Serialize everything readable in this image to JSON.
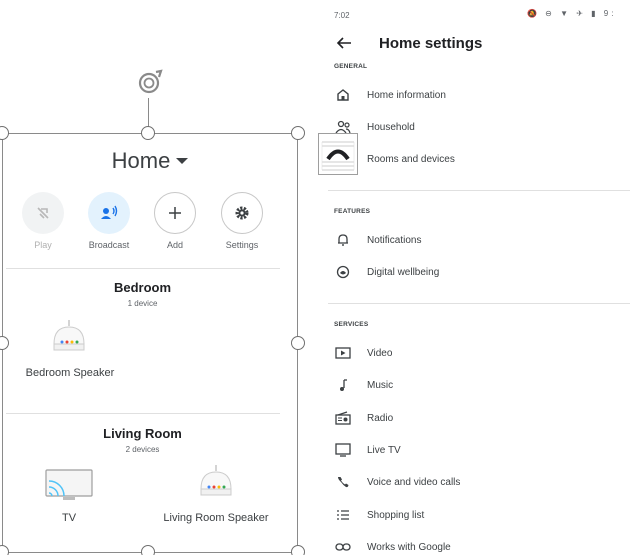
{
  "left_panel": {
    "home_title": "Home",
    "actions": [
      {
        "label": "Play",
        "icon": "play-disabled-icon"
      },
      {
        "label": "Broadcast",
        "icon": "broadcast-icon"
      },
      {
        "label": "Add",
        "icon": "add-icon"
      },
      {
        "label": "Settings",
        "icon": "gear-icon"
      }
    ],
    "rooms": [
      {
        "name": "Bedroom",
        "count": "1 device",
        "devices": [
          {
            "label": "Bedroom Speaker",
            "icon": "speaker-icon"
          }
        ]
      },
      {
        "name": "Living Room",
        "count": "2 devices",
        "devices": [
          {
            "label": "TV",
            "icon": "tv-cast-icon"
          },
          {
            "label": "Living Room Speaker",
            "icon": "speaker-icon"
          }
        ]
      }
    ],
    "colors": {
      "accent": "#1a73e8",
      "broadcast_bg": "#e3f2fd"
    }
  },
  "right_panel": {
    "status_time": "7:02",
    "status_icons": "🔕 ⊖ ▼ ✈ ▮ 9:",
    "title": "Home settings",
    "sections": [
      {
        "header": "GENERAL",
        "items": [
          {
            "label": "Home information",
            "icon": "home-icon"
          },
          {
            "label": "Household",
            "icon": "people-icon"
          },
          {
            "label": "Rooms and devices",
            "icon": "rooms-devices-icon"
          }
        ]
      },
      {
        "header": "FEATURES",
        "items": [
          {
            "label": "Notifications",
            "icon": "bell-icon"
          },
          {
            "label": "Digital wellbeing",
            "icon": "wellbeing-icon"
          }
        ]
      },
      {
        "header": "SERVICES",
        "items": [
          {
            "label": "Video",
            "icon": "video-icon"
          },
          {
            "label": "Music",
            "icon": "music-icon"
          },
          {
            "label": "Radio",
            "icon": "radio-icon"
          },
          {
            "label": "Live TV",
            "icon": "tv-icon"
          },
          {
            "label": "Voice and video calls",
            "icon": "phone-icon"
          },
          {
            "label": "Shopping list",
            "icon": "list-icon"
          },
          {
            "label": "Works with Google",
            "icon": "link-icon"
          }
        ]
      }
    ]
  }
}
